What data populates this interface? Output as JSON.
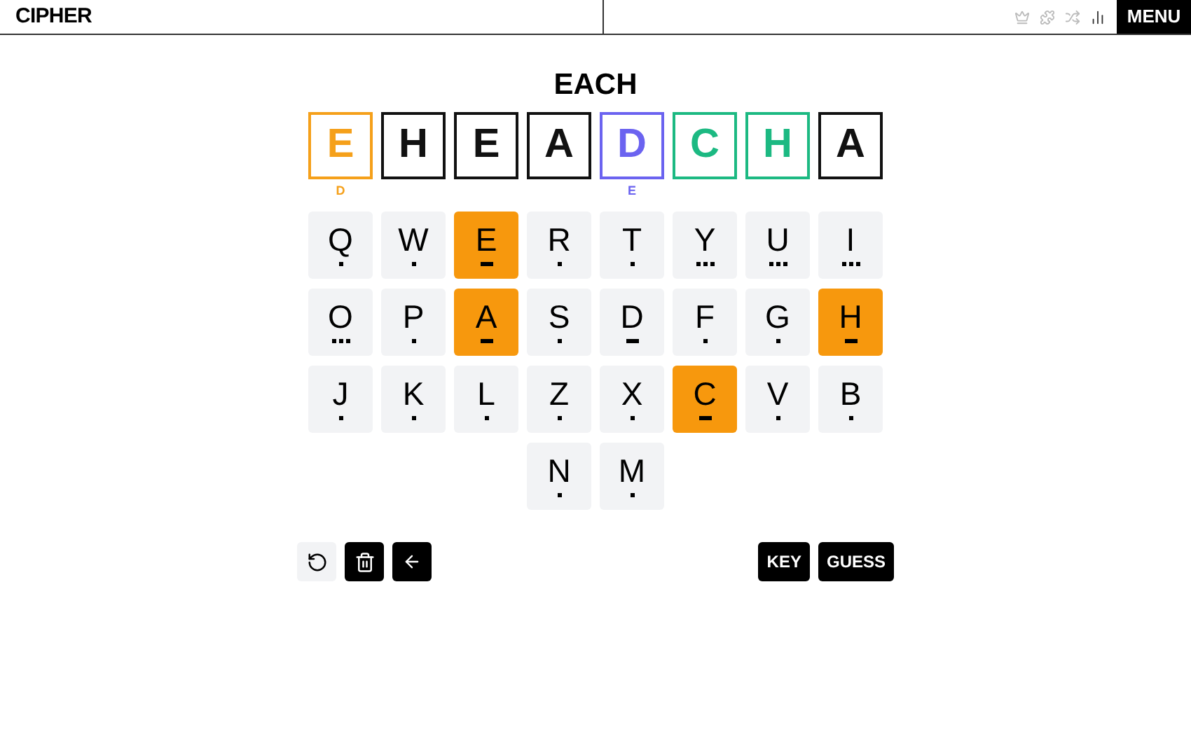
{
  "header": {
    "logo": "CIPHER",
    "menu_button": "MENU"
  },
  "word": "EACH",
  "tiles": [
    {
      "letter": "E",
      "color": "#f5a01a",
      "hint": "D"
    },
    {
      "letter": "H",
      "color": "#111111"
    },
    {
      "letter": "E",
      "color": "#111111"
    },
    {
      "letter": "A",
      "color": "#111111"
    },
    {
      "letter": "D",
      "color": "#6b63f0",
      "hint": "E"
    },
    {
      "letter": "C",
      "color": "#1cb982"
    },
    {
      "letter": "H",
      "color": "#1cb982"
    },
    {
      "letter": "A",
      "color": "#111111"
    }
  ],
  "keyboard": [
    [
      {
        "letter": "Q",
        "kind": "dot",
        "selected": false
      },
      {
        "letter": "W",
        "kind": "dot",
        "selected": false
      },
      {
        "letter": "E",
        "kind": "dash",
        "selected": true
      },
      {
        "letter": "R",
        "kind": "dot",
        "selected": false
      },
      {
        "letter": "T",
        "kind": "dot",
        "selected": false
      },
      {
        "letter": "Y",
        "kind": "dots",
        "selected": false
      },
      {
        "letter": "U",
        "kind": "dots",
        "selected": false
      },
      {
        "letter": "I",
        "kind": "dots",
        "selected": false
      }
    ],
    [
      {
        "letter": "O",
        "kind": "dots",
        "selected": false
      },
      {
        "letter": "P",
        "kind": "dot",
        "selected": false
      },
      {
        "letter": "A",
        "kind": "dash",
        "selected": true
      },
      {
        "letter": "S",
        "kind": "dot",
        "selected": false
      },
      {
        "letter": "D",
        "kind": "dash",
        "selected": false
      },
      {
        "letter": "F",
        "kind": "dot",
        "selected": false
      },
      {
        "letter": "G",
        "kind": "dot",
        "selected": false
      },
      {
        "letter": "H",
        "kind": "dash",
        "selected": true
      }
    ],
    [
      {
        "letter": "J",
        "kind": "dot",
        "selected": false
      },
      {
        "letter": "K",
        "kind": "dot",
        "selected": false
      },
      {
        "letter": "L",
        "kind": "dot",
        "selected": false
      },
      {
        "letter": "Z",
        "kind": "dot",
        "selected": false
      },
      {
        "letter": "X",
        "kind": "dot",
        "selected": false
      },
      {
        "letter": "C",
        "kind": "dash",
        "selected": true
      },
      {
        "letter": "V",
        "kind": "dot",
        "selected": false
      },
      {
        "letter": "B",
        "kind": "dot",
        "selected": false
      }
    ],
    [
      {
        "letter": "N",
        "kind": "dot",
        "selected": false
      },
      {
        "letter": "M",
        "kind": "dot",
        "selected": false
      }
    ]
  ],
  "actions": [
    "KEY",
    "GUESS"
  ]
}
